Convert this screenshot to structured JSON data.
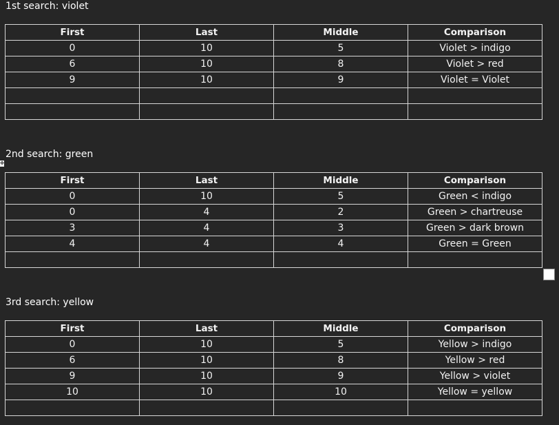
{
  "sections": [
    {
      "heading": "1st search: violet",
      "headers": [
        "First",
        "Last",
        "Middle",
        "Comparison"
      ],
      "rows": [
        [
          "0",
          "10",
          "5",
          "Violet > indigo"
        ],
        [
          "6",
          "10",
          "8",
          "Violet > red"
        ],
        [
          "9",
          "10",
          "9",
          "Violet = Violet"
        ],
        [
          "",
          "",
          "",
          ""
        ],
        [
          "",
          "",
          "",
          ""
        ]
      ]
    },
    {
      "heading": "2nd search: green",
      "headers": [
        "First",
        "Last",
        "Middle",
        "Comparison"
      ],
      "rows": [
        [
          "0",
          "10",
          "5",
          "Green < indigo"
        ],
        [
          "0",
          "4",
          "2",
          "Green > chartreuse"
        ],
        [
          "3",
          "4",
          "3",
          "Green > dark brown"
        ],
        [
          "4",
          "4",
          "4",
          "Green = Green"
        ],
        [
          "",
          "",
          "",
          ""
        ]
      ]
    },
    {
      "heading": "3rd search: yellow",
      "headers": [
        "First",
        "Last",
        "Middle",
        "Comparison"
      ],
      "rows": [
        [
          "0",
          "10",
          "5",
          "Yellow > indigo"
        ],
        [
          "6",
          "10",
          "8",
          "Yellow > red"
        ],
        [
          "9",
          "10",
          "9",
          "Yellow > violet"
        ],
        [
          "10",
          "10",
          "10",
          "Yellow = yellow"
        ],
        [
          "",
          "",
          "",
          ""
        ]
      ]
    }
  ],
  "icons": {
    "table_move_handle": "move-icon",
    "table_resize_handle": "resize-icon"
  }
}
